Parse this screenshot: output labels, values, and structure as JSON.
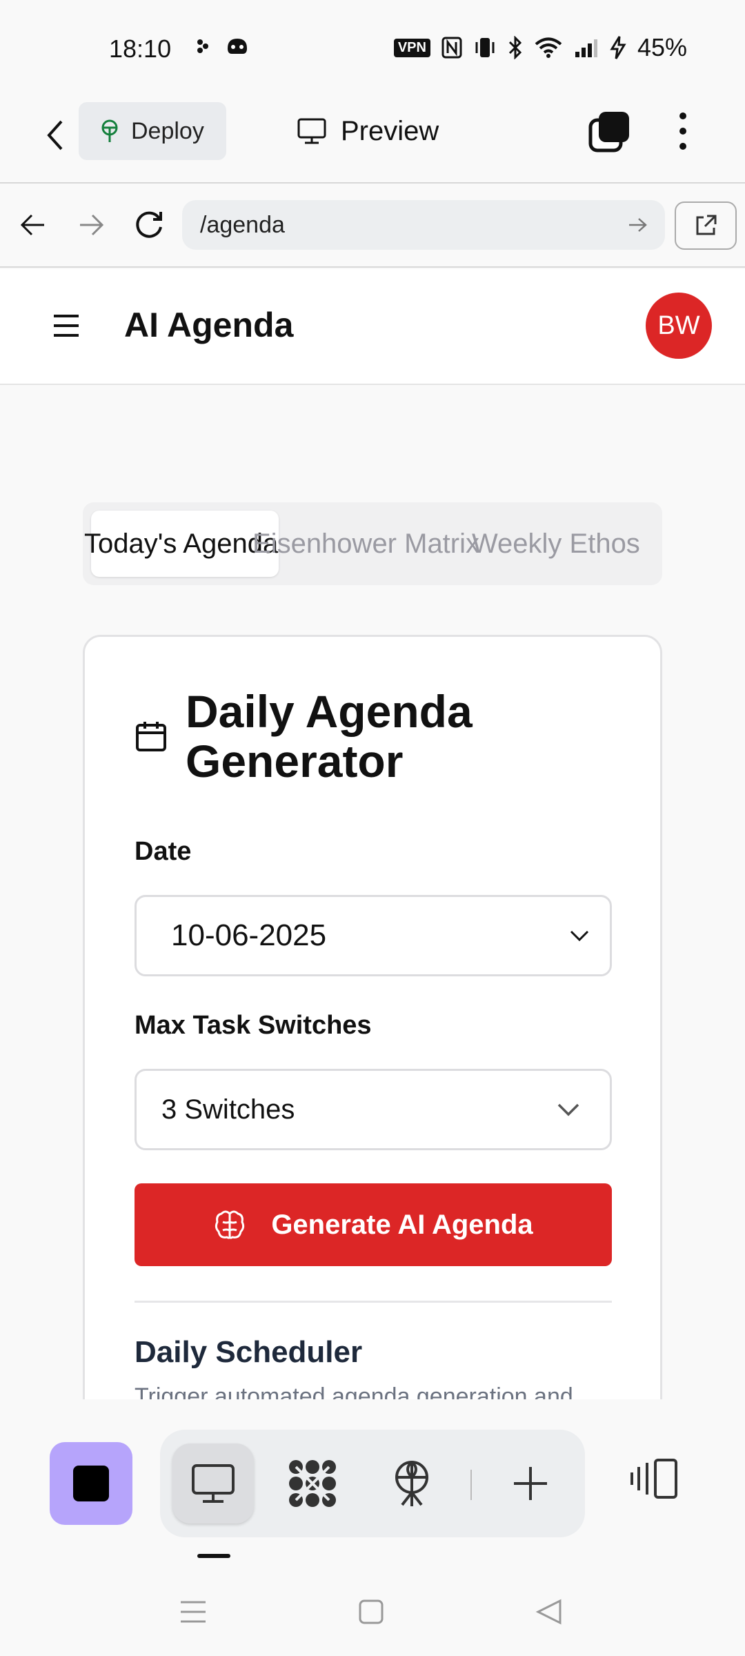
{
  "status_bar": {
    "time": "18:10",
    "vpn": "VPN",
    "battery": "45%",
    "icons": [
      "notification-dots-icon",
      "game-controller-icon",
      "nfc-icon",
      "vibrate-icon",
      "bluetooth-icon",
      "wifi-icon",
      "signal-icon",
      "charging-icon"
    ]
  },
  "app_bar": {
    "deploy_label": "Deploy",
    "preview_label": "Preview"
  },
  "browser": {
    "url": "/agenda"
  },
  "site": {
    "title": "AI Agenda",
    "avatar_initials": "BW",
    "accent_color": "#dc2626"
  },
  "tabs": [
    {
      "label": "Today's Agenda",
      "active": true
    },
    {
      "label": "Eisenhower Matrix",
      "active": false
    },
    {
      "label": "Weekly Ethos",
      "active": false
    }
  ],
  "card": {
    "title": "Daily Agenda Generator",
    "date_label": "Date",
    "date_value": "10-06-2025",
    "switches_label": "Max Task Switches",
    "switches_value": "3 Switches",
    "generate_label": "Generate AI Agenda",
    "scheduler_title": "Daily Scheduler",
    "scheduler_desc": "Trigger automated agenda generation and"
  }
}
